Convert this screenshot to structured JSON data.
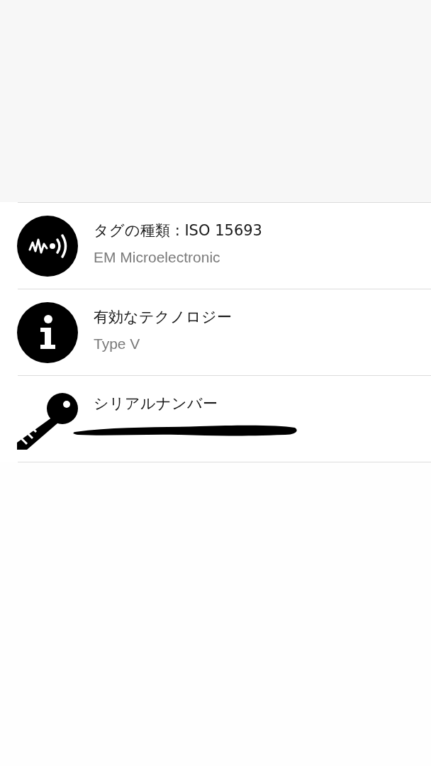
{
  "rows": [
    {
      "kind": "nfc",
      "title": "タグの種類 : ISO 15693",
      "subtitle": "EM Microelectronic",
      "redacted": false
    },
    {
      "kind": "info",
      "title": "有効なテクノロジー",
      "subtitle": "Type V",
      "redacted": false
    },
    {
      "kind": "key",
      "title": "シリアルナンバー",
      "redacted": true
    }
  ]
}
